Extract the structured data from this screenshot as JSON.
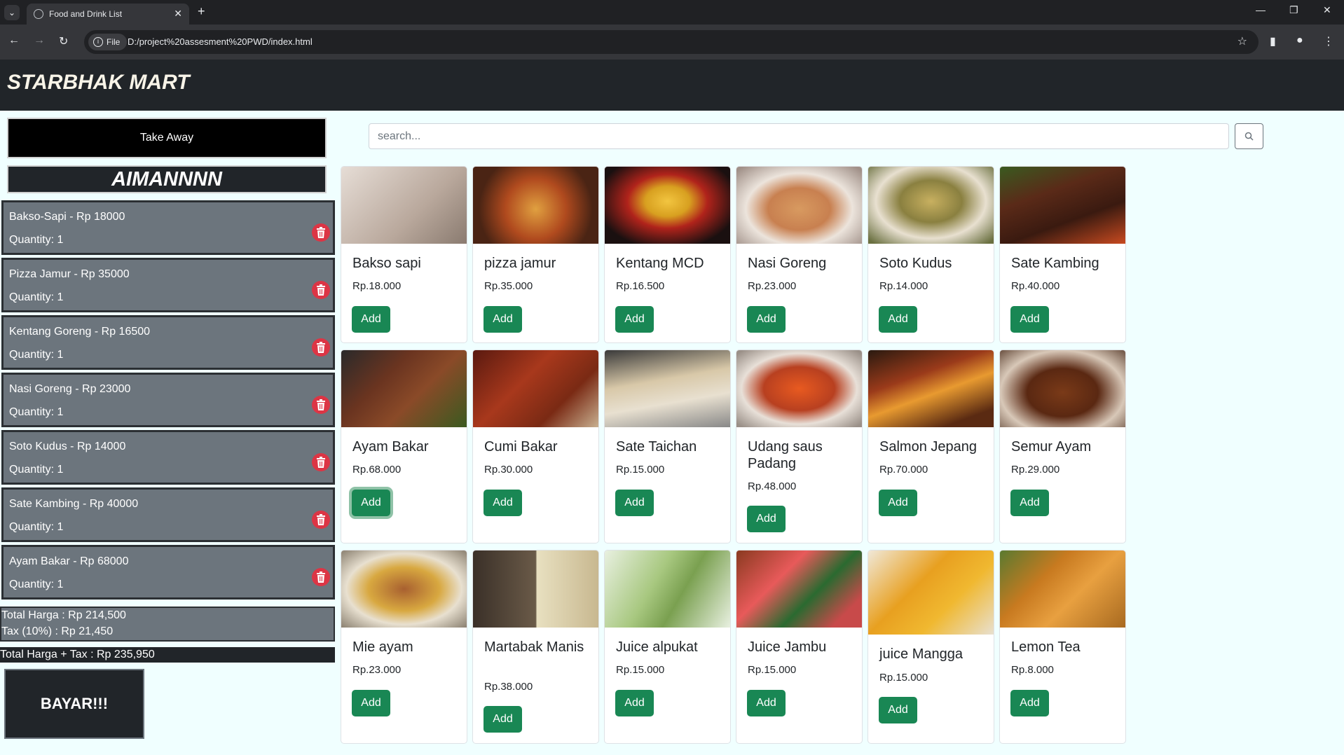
{
  "browser": {
    "tab_title": "Food and Drink List",
    "url_chip": "File",
    "url": "D:/project%20assesment%20PWD/index.html"
  },
  "app": {
    "brand": "STARBHAK MART"
  },
  "order": {
    "mode_label": "Take Away",
    "customer_name": "AIMANNNN",
    "items": [
      {
        "label": "Bakso-Sapi - Rp 18000",
        "qty": "Quantity:  1"
      },
      {
        "label": "Pizza Jamur - Rp 35000",
        "qty": "Quantity:  1"
      },
      {
        "label": "Kentang Goreng - Rp 16500",
        "qty": "Quantity:  1"
      },
      {
        "label": "Nasi Goreng - Rp 23000",
        "qty": "Quantity:  1"
      },
      {
        "label": "Soto Kudus - Rp 14000",
        "qty": "Quantity:  1"
      },
      {
        "label": "Sate Kambing - Rp 40000",
        "qty": "Quantity:  1"
      },
      {
        "label": "Ayam Bakar - Rp 68000",
        "qty": "Quantity:  1"
      }
    ],
    "total": "Total Harga : Rp 214,500",
    "tax": "Tax (10%) : Rp 21,450",
    "grand_total": "Total Harga + Tax : Rp 235,950",
    "pay_label": "BAYAR!!!"
  },
  "search": {
    "placeholder": "search..."
  },
  "add_label": "Add",
  "products": [
    {
      "name": "Bakso sapi",
      "price": "Rp.18.000",
      "color": "#d9c9c0"
    },
    {
      "name": "pizza jamur",
      "price": "Rp.35.000",
      "color": "#8a3a1e"
    },
    {
      "name": "Kentang MCD",
      "price": "Rp.16.500",
      "color": "#b0231b"
    },
    {
      "name": "Nasi Goreng",
      "price": "Rp.23.000",
      "color": "#c89a6a"
    },
    {
      "name": "Soto Kudus",
      "price": "Rp.14.000",
      "color": "#9a8a4a"
    },
    {
      "name": "Sate Kambing",
      "price": "Rp.40.000",
      "color": "#5a2a18"
    },
    {
      "name": "Ayam Bakar",
      "price": "Rp.68.000",
      "color": "#6a3420"
    },
    {
      "name": "Cumi Bakar",
      "price": "Rp.30.000",
      "color": "#8a2e18"
    },
    {
      "name": "Sate Taichan",
      "price": "Rp.15.000",
      "color": "#c8b8a0"
    },
    {
      "name": "Udang saus Padang",
      "price": "Rp.48.000",
      "color": "#b84020"
    },
    {
      "name": "Salmon Jepang",
      "price": "Rp.70.000",
      "color": "#9a3a1a"
    },
    {
      "name": "Semur Ayam",
      "price": "Rp.29.000",
      "color": "#5a2812"
    },
    {
      "name": "Mie ayam",
      "price": "Rp.23.000",
      "color": "#a87830"
    },
    {
      "name": "Martabak Manis",
      "price": "Rp.38.000",
      "color": "#6a5a48"
    },
    {
      "name": "Juice alpukat",
      "price": "Rp.15.000",
      "color": "#a8c880"
    },
    {
      "name": "Juice Jambu",
      "price": "Rp.15.000",
      "color": "#c84a4a"
    },
    {
      "name": "juice Mangga",
      "price": "Rp.15.000",
      "color": "#e8a020"
    },
    {
      "name": "Lemon Tea",
      "price": "Rp.8.000",
      "color": "#c87a20"
    }
  ]
}
